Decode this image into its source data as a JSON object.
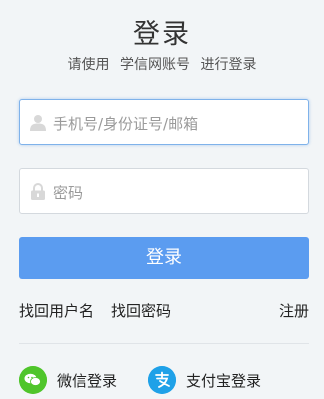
{
  "header": {
    "title": "登录",
    "subtitle_parts": [
      "请使用",
      "学信网账号",
      "进行登录"
    ]
  },
  "form": {
    "account_placeholder": "手机号/身份证号/邮箱",
    "password_placeholder": "密码",
    "submit_label": "登录"
  },
  "links": {
    "recover_username": "找回用户名",
    "recover_password": "找回密码",
    "register": "注册"
  },
  "social": {
    "wechat_label": "微信登录",
    "alipay_label": "支付宝登录"
  },
  "icons": {
    "account": "user-icon",
    "password": "lock-icon",
    "wechat": "wechat-icon",
    "alipay": "alipay-icon"
  },
  "colors": {
    "primary_button": "#5b9cf0",
    "focus_border": "#7fb2ea",
    "wechat": "#4fc52b",
    "alipay": "#1fa1e8"
  }
}
